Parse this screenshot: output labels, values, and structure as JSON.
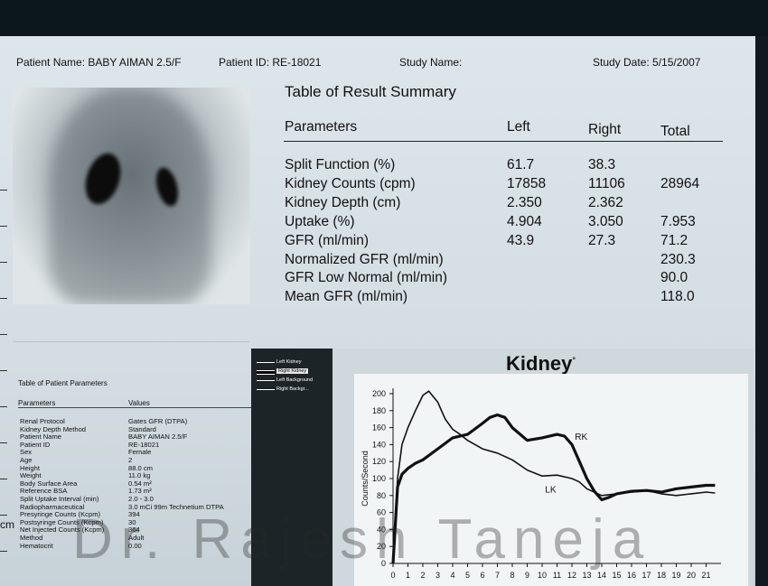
{
  "header": {
    "patient_name": "Patient Name: BABY AIMAN 2.5/F",
    "patient_id": "Patient ID: RE-18021",
    "study_name": "Study Name:",
    "study_date": "Study Date: 5/15/2007"
  },
  "summary": {
    "title": "Table of Result Summary",
    "columns": [
      "Parameters",
      "Left",
      "Right",
      "Total"
    ],
    "rows": [
      {
        "label": "Split Function (%)",
        "left": "61.7",
        "right": "38.3",
        "total": ""
      },
      {
        "label": "Kidney Counts (cpm)",
        "left": "17858",
        "right": "11106",
        "total": "28964"
      },
      {
        "label": "Kidney Depth (cm)",
        "left": "2.350",
        "right": "2.362",
        "total": ""
      },
      {
        "label": "Uptake (%)",
        "left": "4.904",
        "right": "3.050",
        "total": "7.953"
      },
      {
        "label": "GFR (ml/min)",
        "left": "43.9",
        "right": "27.3",
        "total": "71.2"
      },
      {
        "label": "Normalized GFR (ml/min)",
        "left": "",
        "right": "",
        "total": "230.3"
      },
      {
        "label": "GFR Low Normal (ml/min)",
        "left": "",
        "right": "",
        "total": "90.0"
      },
      {
        "label": "Mean GFR (ml/min)",
        "left": "",
        "right": "",
        "total": "118.0"
      }
    ]
  },
  "patient_params": {
    "title": "Table of Patient Parameters",
    "columns": [
      "Parameters",
      "Values"
    ],
    "rows": [
      {
        "label": "Renal Protocol",
        "value": "Gates GFR (DTPA)"
      },
      {
        "label": "Kidney Depth Method",
        "value": "Standard"
      },
      {
        "label": "Patient Name",
        "value": "BABY AIMAN 2.5/F"
      },
      {
        "label": "Patient ID",
        "value": "RE-18021"
      },
      {
        "label": "Sex",
        "value": "Female"
      },
      {
        "label": "Age",
        "value": "2"
      },
      {
        "label": "Height",
        "value": "88.0 cm"
      },
      {
        "label": "Weight",
        "value": "11.0 kg"
      },
      {
        "label": "Body Surface Area",
        "value": "0.54 m²"
      },
      {
        "label": "Reference BSA",
        "value": "1.73 m²"
      },
      {
        "label": "Split Uptake Interval (min)",
        "value": "2.0 - 3.0"
      },
      {
        "label": "Radiopharmaceutical",
        "value": "3.0 mCi 99m Technetium DTPA"
      },
      {
        "label": "Presyringe Counts (Kcpm)",
        "value": "394"
      },
      {
        "label": "Postsyringe Counts (Kcpm)",
        "value": "30"
      },
      {
        "label": "Net Injected Counts (Kcpm)",
        "value": "364"
      },
      {
        "label": "Method",
        "value": "Adult"
      },
      {
        "label": "Hematocrit",
        "value": "0.00"
      }
    ]
  },
  "legend": [
    "Left Kidney",
    "Right Kidney",
    "Left Background",
    "Right Backgr..."
  ],
  "misc": {
    "watermark": "Dr. Rajesh Taneja",
    "cm_label": "cm"
  },
  "chart_data": {
    "type": "line",
    "title": "Kidney",
    "ylabel": "Counts/Second",
    "xlabel": "",
    "xlim": [
      0,
      22
    ],
    "ylim": [
      0,
      200
    ],
    "x_ticks": [
      0,
      1,
      2,
      3,
      4,
      5,
      6,
      7,
      8,
      9,
      10,
      11,
      12,
      13,
      14,
      15,
      16,
      17,
      18,
      19,
      20,
      21
    ],
    "y_ticks": [
      0,
      20,
      40,
      60,
      80,
      100,
      120,
      140,
      160,
      180,
      200
    ],
    "annotations": [
      "RK",
      "LK"
    ],
    "series": [
      {
        "name": "LK",
        "color": "#111111",
        "x": [
          0,
          0.3,
          0.6,
          1,
          1.5,
          2,
          2.4,
          3,
          3.5,
          4,
          4.5,
          5,
          6,
          7,
          8,
          9,
          10,
          11,
          12,
          12.5,
          13,
          14,
          15,
          16,
          17,
          18,
          19,
          20,
          21,
          21.6
        ],
        "y": [
          0,
          100,
          140,
          160,
          180,
          198,
          203,
          190,
          170,
          158,
          152,
          145,
          135,
          130,
          122,
          110,
          103,
          104,
          100,
          96,
          88,
          80,
          82,
          84,
          86,
          82,
          80,
          82,
          84,
          83
        ]
      },
      {
        "name": "RK",
        "color": "#111111",
        "x": [
          0,
          0.3,
          0.6,
          1,
          1.5,
          2,
          3,
          4,
          5,
          6,
          6.5,
          7,
          7.5,
          8,
          9,
          10,
          11,
          11.5,
          12,
          12.5,
          13,
          13.5,
          14,
          14.5,
          15,
          16,
          17,
          18,
          19,
          20,
          21,
          21.6
        ],
        "y": [
          0,
          90,
          105,
          112,
          118,
          122,
          135,
          148,
          152,
          165,
          172,
          175,
          172,
          160,
          145,
          148,
          152,
          150,
          140,
          120,
          100,
          85,
          75,
          78,
          82,
          85,
          86,
          84,
          88,
          90,
          92,
          92
        ]
      }
    ]
  }
}
